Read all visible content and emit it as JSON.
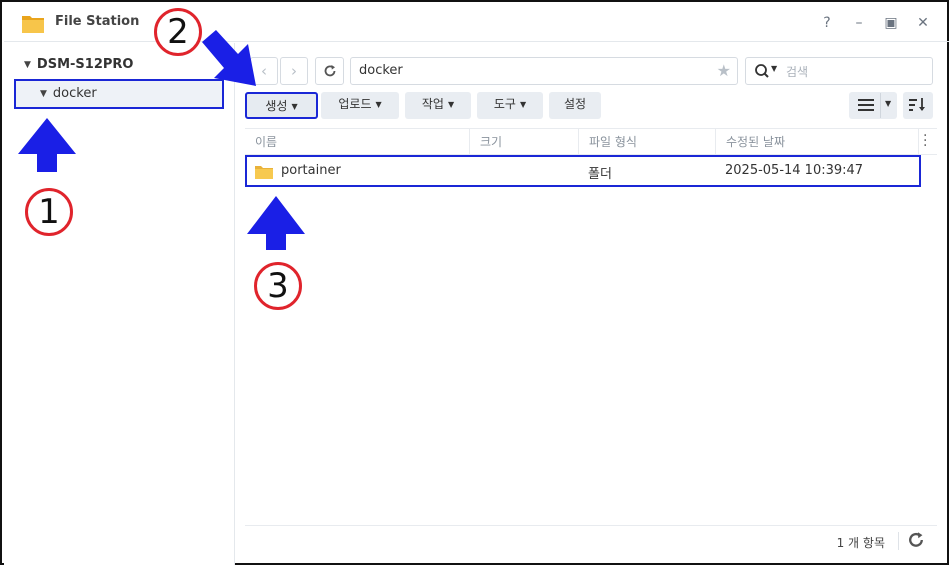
{
  "window": {
    "title": "File Station",
    "controls": {
      "help": "?",
      "minimize": "–",
      "maximize": "▣",
      "close": "✕"
    }
  },
  "sidebar": {
    "root": "DSM-S12PRO",
    "items": [
      {
        "label": "docker",
        "selected": true
      }
    ]
  },
  "navigation": {
    "back": "‹",
    "forward": "›",
    "path": "docker",
    "search_placeholder": "검색"
  },
  "toolbar": {
    "buttons": [
      {
        "label": "생성",
        "dropdown": true
      },
      {
        "label": "업로드",
        "dropdown": true
      },
      {
        "label": "작업",
        "dropdown": true
      },
      {
        "label": "도구",
        "dropdown": true
      },
      {
        "label": "설정",
        "dropdown": false
      }
    ]
  },
  "table": {
    "columns": [
      "이름",
      "크기",
      "파일 형식",
      "수정된 날짜"
    ],
    "rows": [
      {
        "name": "portainer",
        "size": "",
        "type": "폴더",
        "modified": "2025-05-14 10:39:47"
      }
    ]
  },
  "status": {
    "count": "1 개 항목"
  },
  "annotations": {
    "one": "1",
    "two": "2",
    "three": "3"
  },
  "colors": {
    "highlight_border": "#1a27d6",
    "arrow": "#1a1fe6",
    "circle": "#e0242c",
    "folder": "#f4c34a"
  }
}
